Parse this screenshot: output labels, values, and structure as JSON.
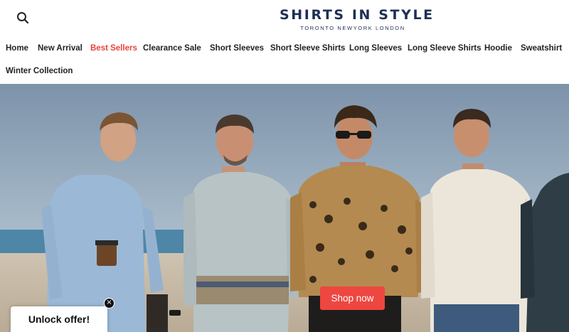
{
  "header": {
    "brand": "SHIRTS IN STYLE",
    "tagline": "TORONTO NEWYORK LONDON",
    "search_icon": "search-icon"
  },
  "nav": {
    "items": [
      {
        "label": "Home",
        "active": false
      },
      {
        "label": "New Arrival",
        "active": false
      },
      {
        "label": "Best Sellers",
        "active": true
      },
      {
        "label": "Clearance Sale",
        "active": false
      },
      {
        "label": "Short Sleeves",
        "active": false
      },
      {
        "label": "Short Sleeve Shirts",
        "active": false
      },
      {
        "label": "Long Sleeves",
        "active": false
      },
      {
        "label": "Long Sleeve Shirts",
        "active": false
      },
      {
        "label": "Hoodie",
        "active": false
      },
      {
        "label": "Sweatshirt",
        "active": false
      },
      {
        "label": "Winter Collection",
        "active": false
      }
    ],
    "active_color": "#e8423a"
  },
  "hero": {
    "cta_label": "Shop now",
    "cta_color": "#ee4640"
  },
  "popup": {
    "label": "Unlock offer!",
    "close_icon": "close-icon"
  },
  "colors": {
    "brand": "#1e2f55"
  }
}
